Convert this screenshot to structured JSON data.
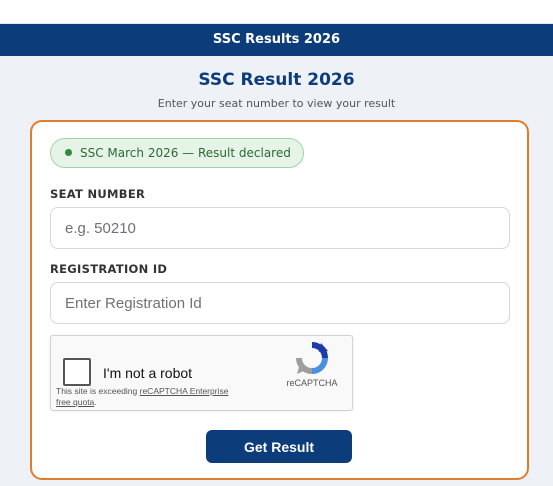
{
  "header": {
    "banner_title": "SSC Results 2026"
  },
  "page": {
    "title": "SSC Result 2026",
    "subtitle": "Enter your seat number to view your result"
  },
  "status": {
    "text": "SSC March 2026 — Result declared"
  },
  "form": {
    "seat_label": "SEAT NUMBER",
    "seat_placeholder": "e.g. 50210",
    "seat_value": "",
    "reg_label": "REGISTRATION ID",
    "reg_placeholder": "Enter Registration Id",
    "reg_value": "",
    "submit_label": "Get Result"
  },
  "captcha": {
    "checkbox_label": "I'm not a robot",
    "brand": "reCAPTCHA",
    "notice_prefix": "This site is exceeding ",
    "notice_link": "reCAPTCHA Enterprise free quota",
    "notice_suffix": ".",
    "logo_icon": "recaptcha-logo-icon"
  },
  "colors": {
    "brand": "#0c3d7a",
    "card_border": "#e07c2e",
    "badge_bg": "#e6f4e8",
    "badge_text": "#2c6a35"
  }
}
